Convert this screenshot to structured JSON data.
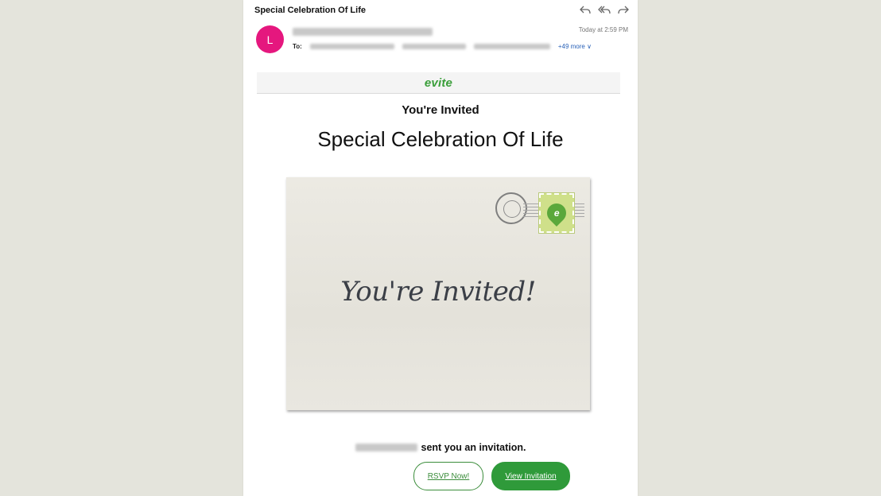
{
  "email": {
    "subject": "Special Celebration Of Life",
    "avatar_letter": "L",
    "date": "Today at 2:59 PM",
    "to_label": "To:",
    "more_recipients": "+49 more ∨",
    "actions": [
      "reply-icon",
      "reply-all-icon",
      "forward-icon"
    ]
  },
  "content": {
    "logo": "evite",
    "heading": "You're Invited",
    "event_title": "Special Celebration Of Life",
    "envelope_text": "You're Invited!",
    "sent_text": "sent you an invitation.",
    "rsvp_label": "RSVP Now!",
    "view_label": "View Invitation"
  },
  "colors": {
    "avatar": "#e5177e",
    "brand_green": "#2f9a3a",
    "background": "#e4e4dc"
  }
}
